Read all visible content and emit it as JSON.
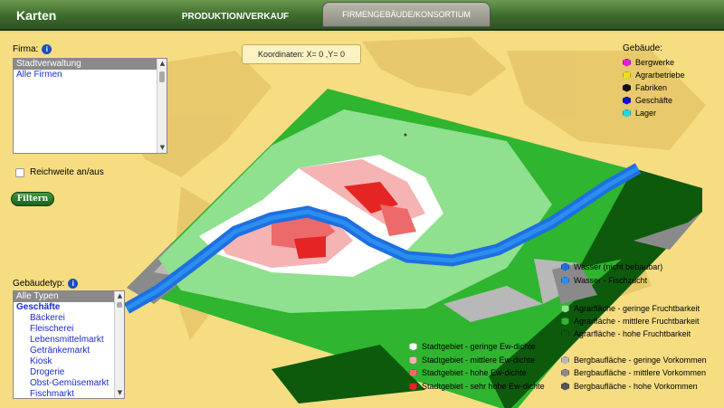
{
  "header": {
    "title": "Karten",
    "tabs": [
      {
        "label": "PRODUKTION/VERKAUF"
      },
      {
        "label": "FIRMENGEBÄUDE/KONSORTIUM"
      }
    ]
  },
  "firma": {
    "label": "Firma:",
    "items": [
      "Stadtverwaltung",
      "Alle Firmen"
    ]
  },
  "reichweite_label": "Reichweite an/aus",
  "filter_button": "Filtern",
  "coords": "Koordinaten: X= 0 ,Y= 0",
  "gebaeudetyp": {
    "label": "Gebäudetyp:",
    "items": [
      {
        "text": "Alle Typen",
        "kind": "sel"
      },
      {
        "text": "Geschäfte",
        "kind": "cat"
      },
      {
        "text": "Bäckerei",
        "kind": "sub"
      },
      {
        "text": "Fleischerei",
        "kind": "sub"
      },
      {
        "text": "Lebensmittelmarkt",
        "kind": "sub"
      },
      {
        "text": "Getränkemarkt",
        "kind": "sub"
      },
      {
        "text": "Kiosk",
        "kind": "sub"
      },
      {
        "text": "Drogerie",
        "kind": "sub"
      },
      {
        "text": "Obst-Gemüsemarkt",
        "kind": "sub"
      },
      {
        "text": "Fischmarkt",
        "kind": "sub"
      }
    ]
  },
  "gebaeude_legend": {
    "label": "Gebäude:",
    "items": [
      {
        "text": "Bergwerke",
        "color": "#e020d0"
      },
      {
        "text": "Agrarbetriebe",
        "color": "#e8e020"
      },
      {
        "text": "Fabriken",
        "color": "#111111"
      },
      {
        "text": "Geschäfte",
        "color": "#1010d0"
      },
      {
        "text": "Lager",
        "color": "#20d8e0"
      }
    ]
  },
  "terrain_legend": [
    {
      "text": "Wasser (nicht bebaubar)",
      "color": "#1e6fe0"
    },
    {
      "text": "Wasser - Fischzucht",
      "color": "#2a8ef0"
    },
    {
      "text": "Agrarfläche - geringe Fruchtbarkeit",
      "color": "#8fe08f"
    },
    {
      "text": "Agrarfläche - mittlere Fruchtbarkeit",
      "color": "#2fb52f"
    },
    {
      "text": "Agrarfläche - hohe Fruchtbarkeit",
      "color": "#0d5a0d"
    },
    {
      "text": "Bergbaufläche - geringe Vorkommen",
      "color": "#b8b8b8"
    },
    {
      "text": "Bergbaufläche - mittlere Vorkommen",
      "color": "#8a8a8a"
    },
    {
      "text": "Bergbaufläche - hohe Vorkommen",
      "color": "#555555"
    }
  ],
  "city_legend": [
    {
      "text": "Stadtgebiet - geringe Ew-dichte",
      "color": "#ffffff"
    },
    {
      "text": "Stadtgebiet - mittlere Ew-dichte",
      "color": "#f5b3b3"
    },
    {
      "text": "Stadtgebiet - hohe Ew-dichte",
      "color": "#ec6a6a"
    },
    {
      "text": "Stadtgebiet - sehr hohe Ew-dichte",
      "color": "#e52424"
    }
  ]
}
